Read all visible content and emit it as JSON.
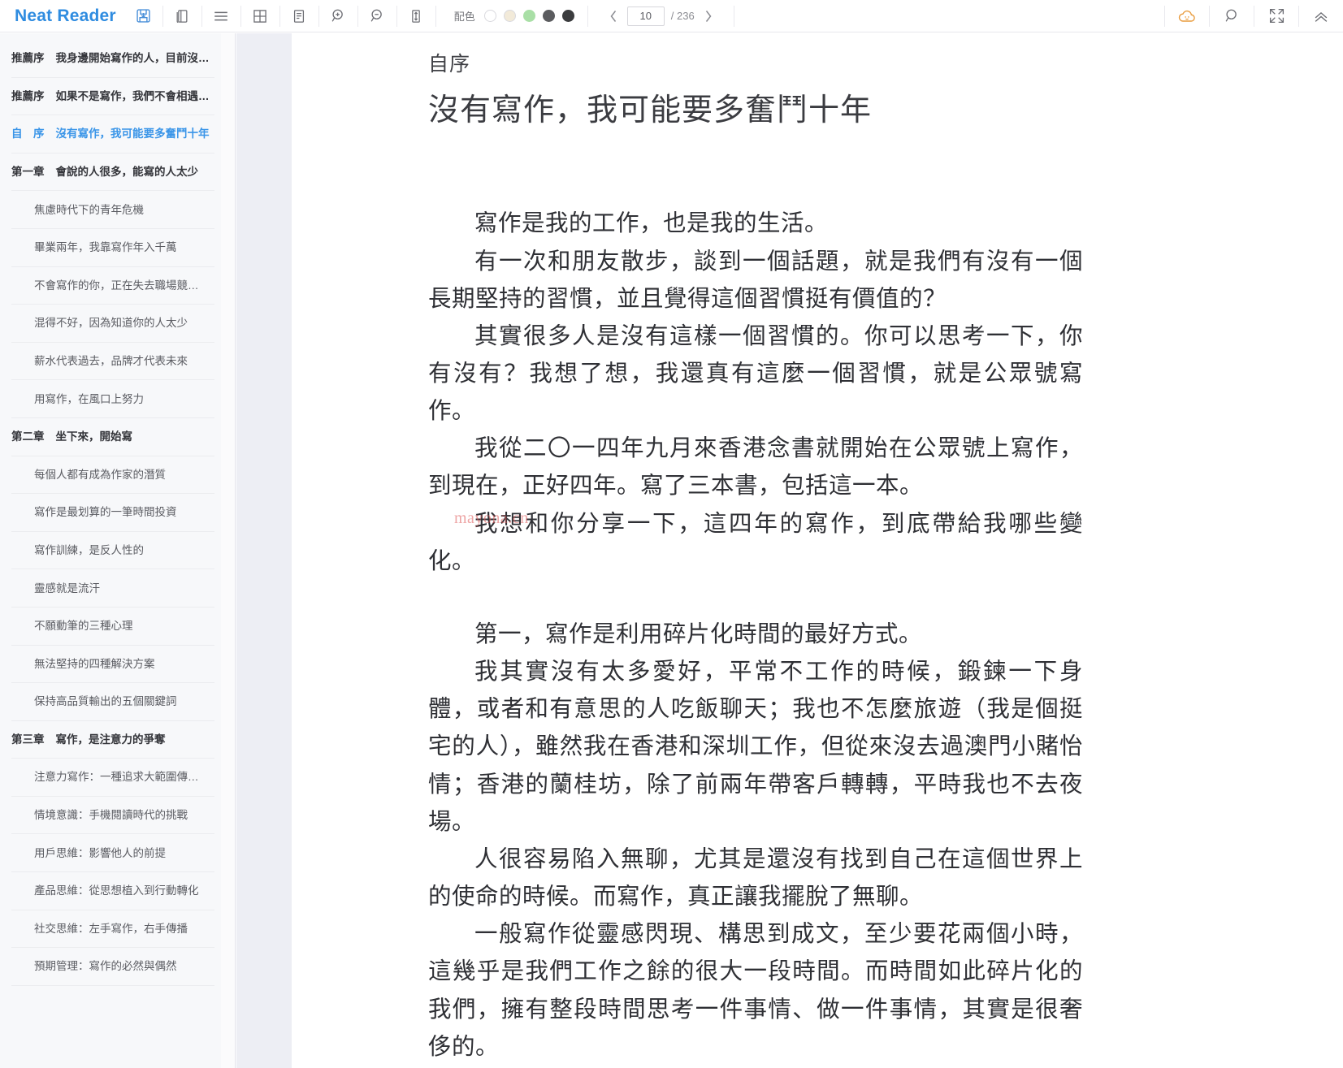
{
  "app": {
    "brand": "Neat Reader"
  },
  "toolbar": {
    "icons": [
      {
        "name": "save-icon",
        "label": "保存"
      },
      {
        "name": "library-icon",
        "label": "書庫"
      },
      {
        "name": "toc-icon",
        "label": "目錄"
      },
      {
        "name": "grid-view-icon",
        "label": "網格視圖"
      },
      {
        "name": "notes-icon",
        "label": "筆記"
      },
      {
        "name": "zoom-in-icon",
        "label": "放大"
      },
      {
        "name": "zoom-out-icon",
        "label": "縮小"
      },
      {
        "name": "line-height-icon",
        "label": "行距"
      }
    ],
    "palette": {
      "label": "配色",
      "swatches": [
        {
          "name": "theme-white",
          "color": "#ffffff",
          "selected": false
        },
        {
          "name": "theme-sepia",
          "color": "#f2ead9",
          "selected": false
        },
        {
          "name": "theme-green",
          "color": "#a9dfa6",
          "selected": false
        },
        {
          "name": "theme-gray",
          "color": "#5b5c5f",
          "selected": false
        },
        {
          "name": "theme-dark",
          "color": "#3b3c3e",
          "selected": false
        }
      ]
    },
    "pager": {
      "prev": "‹",
      "next": "›",
      "current": "10",
      "placeholder": "10",
      "total": "/ 236"
    },
    "right_icons": [
      {
        "name": "cloud-sync-icon",
        "label": "雲同步",
        "color": "#e99b3c"
      },
      {
        "name": "search-icon",
        "label": "搜尋",
        "color": "#5c5d63"
      },
      {
        "name": "fullscreen-exit-icon",
        "label": "退出全屏",
        "color": "#5c5d63"
      },
      {
        "name": "collapse-up-icon",
        "label": "收起",
        "color": "#5c5d63"
      }
    ]
  },
  "sidebar": {
    "items": [
      {
        "level": "chapter",
        "prefix": "推薦序",
        "text": "我身邊開始寫作的人，目前沒…",
        "active": false
      },
      {
        "level": "chapter",
        "prefix": "推薦序",
        "text": "如果不是寫作，我們不會相遇…",
        "active": false
      },
      {
        "level": "chapter",
        "prefix": "自　序",
        "text": "沒有寫作，我可能要多奮鬥十年",
        "active": true
      },
      {
        "level": "chapter",
        "prefix": "第一章",
        "text": "會說的人很多，能寫的人太少",
        "active": false
      },
      {
        "level": "sub",
        "prefix": "",
        "text": "焦慮時代下的青年危機",
        "active": false
      },
      {
        "level": "sub",
        "prefix": "",
        "text": "畢業兩年，我靠寫作年入千萬",
        "active": false
      },
      {
        "level": "sub",
        "prefix": "",
        "text": "不會寫作的你，正在失去職場競…",
        "active": false
      },
      {
        "level": "sub",
        "prefix": "",
        "text": "混得不好，因為知道你的人太少",
        "active": false
      },
      {
        "level": "sub",
        "prefix": "",
        "text": "薪水代表過去，品牌才代表未來",
        "active": false
      },
      {
        "level": "sub",
        "prefix": "",
        "text": "用寫作，在風口上努力",
        "active": false
      },
      {
        "level": "chapter",
        "prefix": "第二章",
        "text": "坐下來，開始寫",
        "active": false
      },
      {
        "level": "sub",
        "prefix": "",
        "text": "每個人都有成為作家的潛質",
        "active": false
      },
      {
        "level": "sub",
        "prefix": "",
        "text": "寫作是最划算的一筆時間投資",
        "active": false
      },
      {
        "level": "sub",
        "prefix": "",
        "text": "寫作訓練，是反人性的",
        "active": false
      },
      {
        "level": "sub",
        "prefix": "",
        "text": "靈感就是流汗",
        "active": false
      },
      {
        "level": "sub",
        "prefix": "",
        "text": "不願動筆的三種心理",
        "active": false
      },
      {
        "level": "sub",
        "prefix": "",
        "text": "無法堅持的四種解決方案",
        "active": false
      },
      {
        "level": "sub",
        "prefix": "",
        "text": "保持高品質輸出的五個關鍵詞",
        "active": false
      },
      {
        "level": "chapter",
        "prefix": "第三章",
        "text": "寫作，是注意力的爭奪",
        "active": false
      },
      {
        "level": "sub",
        "prefix": "",
        "text": "注意力寫作：一種追求大範圍傳…",
        "active": false
      },
      {
        "level": "sub",
        "prefix": "",
        "text": "情境意識：手機閱讀時代的挑戰",
        "active": false
      },
      {
        "level": "sub",
        "prefix": "",
        "text": "用戶思維：影響他人的前提",
        "active": false
      },
      {
        "level": "sub",
        "prefix": "",
        "text": "產品思維：從思想植入到行動轉化",
        "active": false
      },
      {
        "level": "sub",
        "prefix": "",
        "text": "社交思維：左手寫作，右手傳播",
        "active": false
      },
      {
        "level": "sub",
        "prefix": "",
        "text": "預期管理：寫作的必然與偶然",
        "active": false
      }
    ]
  },
  "content": {
    "kicker": "自序",
    "headline": "沒有寫作，我可能要多奮鬥十年",
    "watermark": "mayona.cn",
    "paragraphs": [
      "寫作是我的工作，也是我的生活。",
      "有一次和朋友散步，談到一個話題，就是我們有沒有一個長期堅持的習慣，並且覺得這個習慣挺有價值的？",
      "其實很多人是沒有這樣一個習慣的。你可以思考一下，你有沒有？我想了想，我還真有這麼一個習慣，就是公眾號寫作。",
      "我從二〇一四年九月來香港念書就開始在公眾號上寫作，到現在，正好四年。寫了三本書，包括這一本。",
      "我想和你分享一下，這四年的寫作，到底帶給我哪些變化。"
    ],
    "paragraphs2": [
      "第一，寫作是利用碎片化時間的最好方式。",
      "我其實沒有太多愛好，平常不工作的時候，鍛鍊一下身體，或者和有意思的人吃飯聊天；我也不怎麼旅遊（我是個挺宅的人），雖然我在香港和深圳工作，但從來沒去過澳門小賭怡情；香港的蘭桂坊，除了前兩年帶客戶轉轉，平時我也不去夜場。",
      "人很容易陷入無聊，尤其是還沒有找到自己在這個世界上的使命的時候。而寫作，真正讓我擺脫了無聊。",
      "一般寫作從靈感閃現、構思到成文，至少要花兩個小時，這幾乎是我們工作之餘的很大一段時間。而時間如此碎片化的我們，擁有整段時間思考一件事情、做一件事情，其實是很奢侈的。"
    ]
  }
}
